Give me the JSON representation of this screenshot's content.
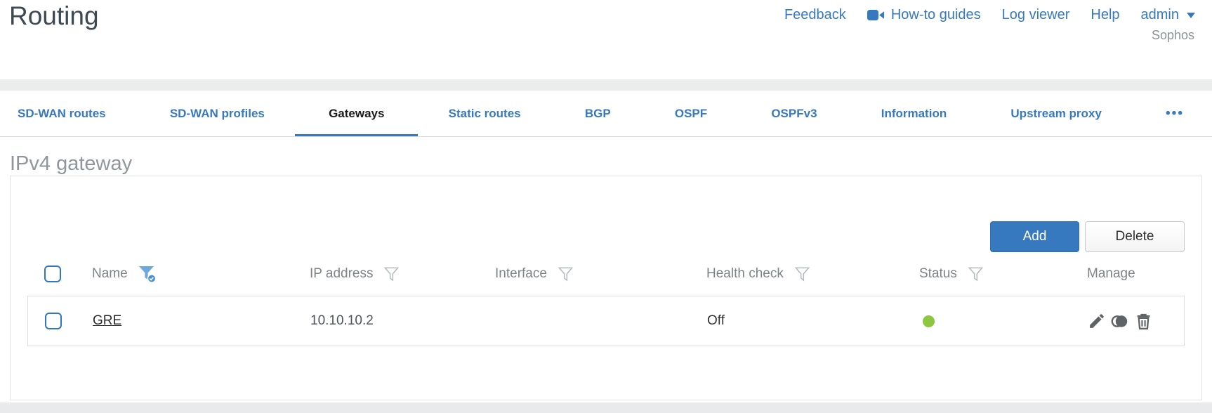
{
  "header": {
    "title": "Routing",
    "nav": {
      "feedback": "Feedback",
      "howto": "How-to guides",
      "log_viewer": "Log viewer",
      "help": "Help",
      "user": "admin",
      "brand": "Sophos"
    }
  },
  "tabs": [
    {
      "label": "SD-WAN routes",
      "active": false
    },
    {
      "label": "SD-WAN profiles",
      "active": false
    },
    {
      "label": "Gateways",
      "active": true
    },
    {
      "label": "Static routes",
      "active": false
    },
    {
      "label": "BGP",
      "active": false
    },
    {
      "label": "OSPF",
      "active": false
    },
    {
      "label": "OSPFv3",
      "active": false
    },
    {
      "label": "Information",
      "active": false
    },
    {
      "label": "Upstream proxy",
      "active": false
    },
    {
      "label": "•••",
      "active": false
    }
  ],
  "section": {
    "heading": "IPv4 gateway"
  },
  "toolbar": {
    "add": "Add",
    "delete": "Delete"
  },
  "table": {
    "columns": [
      {
        "label": "Name",
        "filter": "active"
      },
      {
        "label": "IP address",
        "filter": "inactive"
      },
      {
        "label": "Interface",
        "filter": "inactive"
      },
      {
        "label": "Health check",
        "filter": "inactive"
      },
      {
        "label": "Status",
        "filter": "inactive"
      },
      {
        "label": "Manage",
        "filter": "none"
      }
    ],
    "rows": [
      {
        "name": "GRE",
        "ip_address": "10.10.10.2",
        "interface": "",
        "health_check": "Off",
        "status": "up"
      }
    ]
  },
  "icons": {
    "howto": "video-camera-icon",
    "user_caret": "chevron-down-icon",
    "filter_active": "funnel-check-icon",
    "filter": "funnel-icon",
    "edit": "pencil-icon",
    "clone": "clone-icon",
    "delete": "trash-icon",
    "status_up": "green-dot",
    "overflow": "ellipsis-icon"
  },
  "colors": {
    "accent": "#3779be",
    "link": "#3779be",
    "title": "#3d4852",
    "heading": "#8e979b",
    "status_up": "#8dc63f",
    "icon_gray": "#5f6365",
    "muted": "#7d8487",
    "border": "#e2e2e2"
  }
}
